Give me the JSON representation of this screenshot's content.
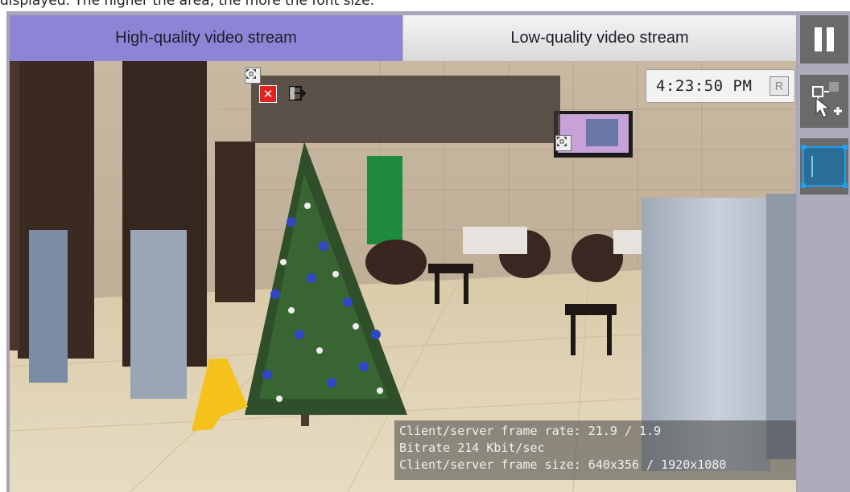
{
  "caption": "displayed. The higher the area, the more the font size.",
  "tabs": [
    {
      "label": "High-quality video stream",
      "active": true
    },
    {
      "label": "Low-quality video stream",
      "active": false
    }
  ],
  "overlay": {
    "time": "4:23:50 PM",
    "time_button": "R"
  },
  "stats": {
    "frame_rate": "Client/server frame rate: 21.9 / 1.9",
    "bitrate": "Bitrate 214 Kbit/sec",
    "frame_size": "Client/server frame size: 640x356 / 1920x1080"
  },
  "toolbar": {
    "items": [
      {
        "icon": "pause-icon"
      },
      {
        "icon": "add-region-icon"
      },
      {
        "icon": "region-select-icon"
      }
    ]
  },
  "colors": {
    "active_tab": "#8e84d6",
    "toolbar_button": "#6a6a6a",
    "selection_accent": "#1ea0f0"
  }
}
